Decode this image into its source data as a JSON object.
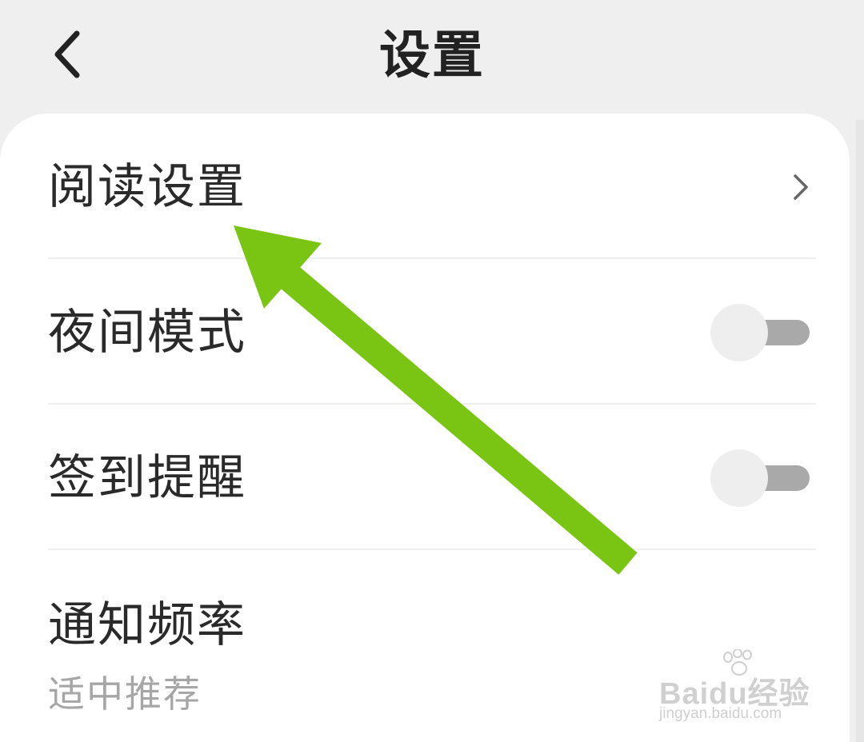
{
  "header": {
    "title": "设置",
    "back_icon": "chevron-left-icon"
  },
  "settings": {
    "reading": {
      "label": "阅读设置",
      "icon": "chevron-right-icon"
    },
    "night_mode": {
      "label": "夜间模式",
      "enabled": false
    },
    "checkin_reminder": {
      "label": "签到提醒",
      "enabled": false
    },
    "notification_frequency": {
      "label": "通知频率",
      "value": "适中推荐"
    }
  },
  "annotation": {
    "color": "#7ac514",
    "icon": "pointer-arrow-icon"
  },
  "watermark": {
    "logo_text": "Baidu经验",
    "url": "jingyan.baidu.com"
  },
  "colors": {
    "background": "#efefef",
    "card": "#ffffff",
    "text": "#2a2a2a",
    "subtext": "#a6a6a6",
    "toggle_track": "#a9a9a9",
    "toggle_knob": "#eeeeee"
  }
}
